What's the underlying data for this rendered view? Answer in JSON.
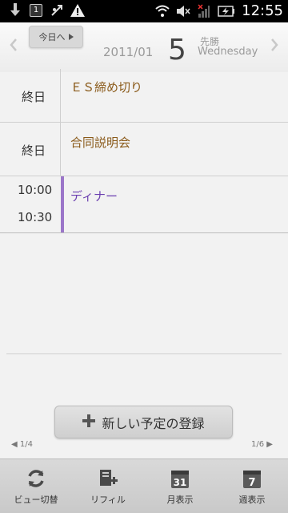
{
  "status_bar": {
    "time": "12:55",
    "icons": [
      "download-icon",
      "notification-count-icon",
      "usb-debug-icon",
      "warning-icon",
      "wifi-icon",
      "mute-icon",
      "no-signal-icon",
      "battery-charging-icon"
    ],
    "notification_count": "1"
  },
  "header": {
    "today_label": "今日へ",
    "year_month": "2011/01",
    "day": "5",
    "rokuyo": "先勝",
    "weekday": "Wednesday"
  },
  "events": [
    {
      "time_label": "終日",
      "title": "ＥＳ締め切り",
      "color": "#8a5a1a"
    },
    {
      "time_label": "終日",
      "title": "合同説明会",
      "color": "#8a5a1a"
    },
    {
      "start": "10:00",
      "end": "10:30",
      "title": "ディナー",
      "color": "#6b3fb0",
      "bar_color": "#9b76c9"
    }
  ],
  "add_button_label": "新しい予定の登録",
  "pagination": {
    "left": "1/4",
    "right": "1/6"
  },
  "toolbar": [
    {
      "label": "ビュー切替",
      "icon": "refresh-icon"
    },
    {
      "label": "リフィル",
      "icon": "refill-add-icon"
    },
    {
      "label": "月表示",
      "icon": "calendar-31-icon",
      "num": "31"
    },
    {
      "label": "週表示",
      "icon": "calendar-7-icon",
      "num": "7"
    }
  ]
}
